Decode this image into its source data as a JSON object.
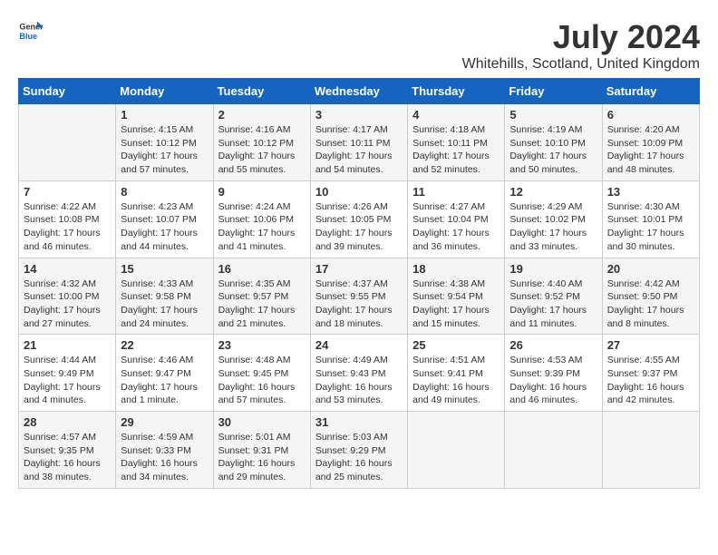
{
  "header": {
    "logo_general": "General",
    "logo_blue": "Blue",
    "title": "July 2024",
    "subtitle": "Whitehills, Scotland, United Kingdom"
  },
  "calendar": {
    "days_of_week": [
      "Sunday",
      "Monday",
      "Tuesday",
      "Wednesday",
      "Thursday",
      "Friday",
      "Saturday"
    ],
    "weeks": [
      [
        {
          "day": "",
          "info": ""
        },
        {
          "day": "1",
          "info": "Sunrise: 4:15 AM\nSunset: 10:12 PM\nDaylight: 17 hours\nand 57 minutes."
        },
        {
          "day": "2",
          "info": "Sunrise: 4:16 AM\nSunset: 10:12 PM\nDaylight: 17 hours\nand 55 minutes."
        },
        {
          "day": "3",
          "info": "Sunrise: 4:17 AM\nSunset: 10:11 PM\nDaylight: 17 hours\nand 54 minutes."
        },
        {
          "day": "4",
          "info": "Sunrise: 4:18 AM\nSunset: 10:11 PM\nDaylight: 17 hours\nand 52 minutes."
        },
        {
          "day": "5",
          "info": "Sunrise: 4:19 AM\nSunset: 10:10 PM\nDaylight: 17 hours\nand 50 minutes."
        },
        {
          "day": "6",
          "info": "Sunrise: 4:20 AM\nSunset: 10:09 PM\nDaylight: 17 hours\nand 48 minutes."
        }
      ],
      [
        {
          "day": "7",
          "info": "Sunrise: 4:22 AM\nSunset: 10:08 PM\nDaylight: 17 hours\nand 46 minutes."
        },
        {
          "day": "8",
          "info": "Sunrise: 4:23 AM\nSunset: 10:07 PM\nDaylight: 17 hours\nand 44 minutes."
        },
        {
          "day": "9",
          "info": "Sunrise: 4:24 AM\nSunset: 10:06 PM\nDaylight: 17 hours\nand 41 minutes."
        },
        {
          "day": "10",
          "info": "Sunrise: 4:26 AM\nSunset: 10:05 PM\nDaylight: 17 hours\nand 39 minutes."
        },
        {
          "day": "11",
          "info": "Sunrise: 4:27 AM\nSunset: 10:04 PM\nDaylight: 17 hours\nand 36 minutes."
        },
        {
          "day": "12",
          "info": "Sunrise: 4:29 AM\nSunset: 10:02 PM\nDaylight: 17 hours\nand 33 minutes."
        },
        {
          "day": "13",
          "info": "Sunrise: 4:30 AM\nSunset: 10:01 PM\nDaylight: 17 hours\nand 30 minutes."
        }
      ],
      [
        {
          "day": "14",
          "info": "Sunrise: 4:32 AM\nSunset: 10:00 PM\nDaylight: 17 hours\nand 27 minutes."
        },
        {
          "day": "15",
          "info": "Sunrise: 4:33 AM\nSunset: 9:58 PM\nDaylight: 17 hours\nand 24 minutes."
        },
        {
          "day": "16",
          "info": "Sunrise: 4:35 AM\nSunset: 9:57 PM\nDaylight: 17 hours\nand 21 minutes."
        },
        {
          "day": "17",
          "info": "Sunrise: 4:37 AM\nSunset: 9:55 PM\nDaylight: 17 hours\nand 18 minutes."
        },
        {
          "day": "18",
          "info": "Sunrise: 4:38 AM\nSunset: 9:54 PM\nDaylight: 17 hours\nand 15 minutes."
        },
        {
          "day": "19",
          "info": "Sunrise: 4:40 AM\nSunset: 9:52 PM\nDaylight: 17 hours\nand 11 minutes."
        },
        {
          "day": "20",
          "info": "Sunrise: 4:42 AM\nSunset: 9:50 PM\nDaylight: 17 hours\nand 8 minutes."
        }
      ],
      [
        {
          "day": "21",
          "info": "Sunrise: 4:44 AM\nSunset: 9:49 PM\nDaylight: 17 hours\nand 4 minutes."
        },
        {
          "day": "22",
          "info": "Sunrise: 4:46 AM\nSunset: 9:47 PM\nDaylight: 17 hours\nand 1 minute."
        },
        {
          "day": "23",
          "info": "Sunrise: 4:48 AM\nSunset: 9:45 PM\nDaylight: 16 hours\nand 57 minutes."
        },
        {
          "day": "24",
          "info": "Sunrise: 4:49 AM\nSunset: 9:43 PM\nDaylight: 16 hours\nand 53 minutes."
        },
        {
          "day": "25",
          "info": "Sunrise: 4:51 AM\nSunset: 9:41 PM\nDaylight: 16 hours\nand 49 minutes."
        },
        {
          "day": "26",
          "info": "Sunrise: 4:53 AM\nSunset: 9:39 PM\nDaylight: 16 hours\nand 46 minutes."
        },
        {
          "day": "27",
          "info": "Sunrise: 4:55 AM\nSunset: 9:37 PM\nDaylight: 16 hours\nand 42 minutes."
        }
      ],
      [
        {
          "day": "28",
          "info": "Sunrise: 4:57 AM\nSunset: 9:35 PM\nDaylight: 16 hours\nand 38 minutes."
        },
        {
          "day": "29",
          "info": "Sunrise: 4:59 AM\nSunset: 9:33 PM\nDaylight: 16 hours\nand 34 minutes."
        },
        {
          "day": "30",
          "info": "Sunrise: 5:01 AM\nSunset: 9:31 PM\nDaylight: 16 hours\nand 29 minutes."
        },
        {
          "day": "31",
          "info": "Sunrise: 5:03 AM\nSunset: 9:29 PM\nDaylight: 16 hours\nand 25 minutes."
        },
        {
          "day": "",
          "info": ""
        },
        {
          "day": "",
          "info": ""
        },
        {
          "day": "",
          "info": ""
        }
      ]
    ]
  }
}
